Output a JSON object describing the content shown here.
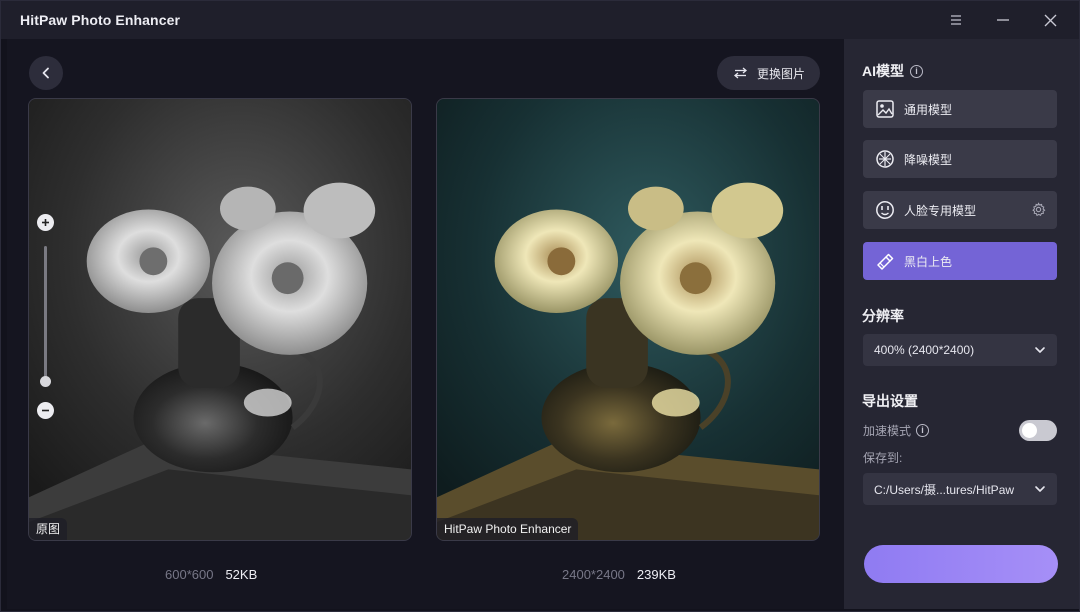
{
  "app": {
    "title": "HitPaw Photo Enhancer"
  },
  "toolbar": {
    "swap_label": "更换图片"
  },
  "preview": {
    "original": {
      "tag": "原图",
      "dimensions": "600*600",
      "size": "52KB"
    },
    "enhanced": {
      "tag": "HitPaw Photo Enhancer",
      "dimensions": "2400*2400",
      "size": "239KB"
    },
    "zoom_level": 0.07
  },
  "sidebar": {
    "ai_model": {
      "title": "AI模型",
      "models": [
        {
          "label": "通用模型",
          "icon": "image-icon",
          "active": false
        },
        {
          "label": "降噪模型",
          "icon": "denoise-icon",
          "active": false
        },
        {
          "label": "人脸专用模型",
          "icon": "face-icon",
          "active": false
        },
        {
          "label": "黑白上色",
          "icon": "colorize-icon",
          "active": true
        }
      ]
    },
    "resolution": {
      "title": "分辨率",
      "value": "400% (2400*2400)"
    },
    "export": {
      "title": "导出设置",
      "accel_label": "加速模式",
      "accel_on": false,
      "save_to_label": "保存到:",
      "save_path": "C:/Users/摄...tures/HitPaw"
    }
  },
  "colors": {
    "accent": "#7464d6",
    "export_button": "#9a86f5",
    "panel_bg": "#262633"
  }
}
